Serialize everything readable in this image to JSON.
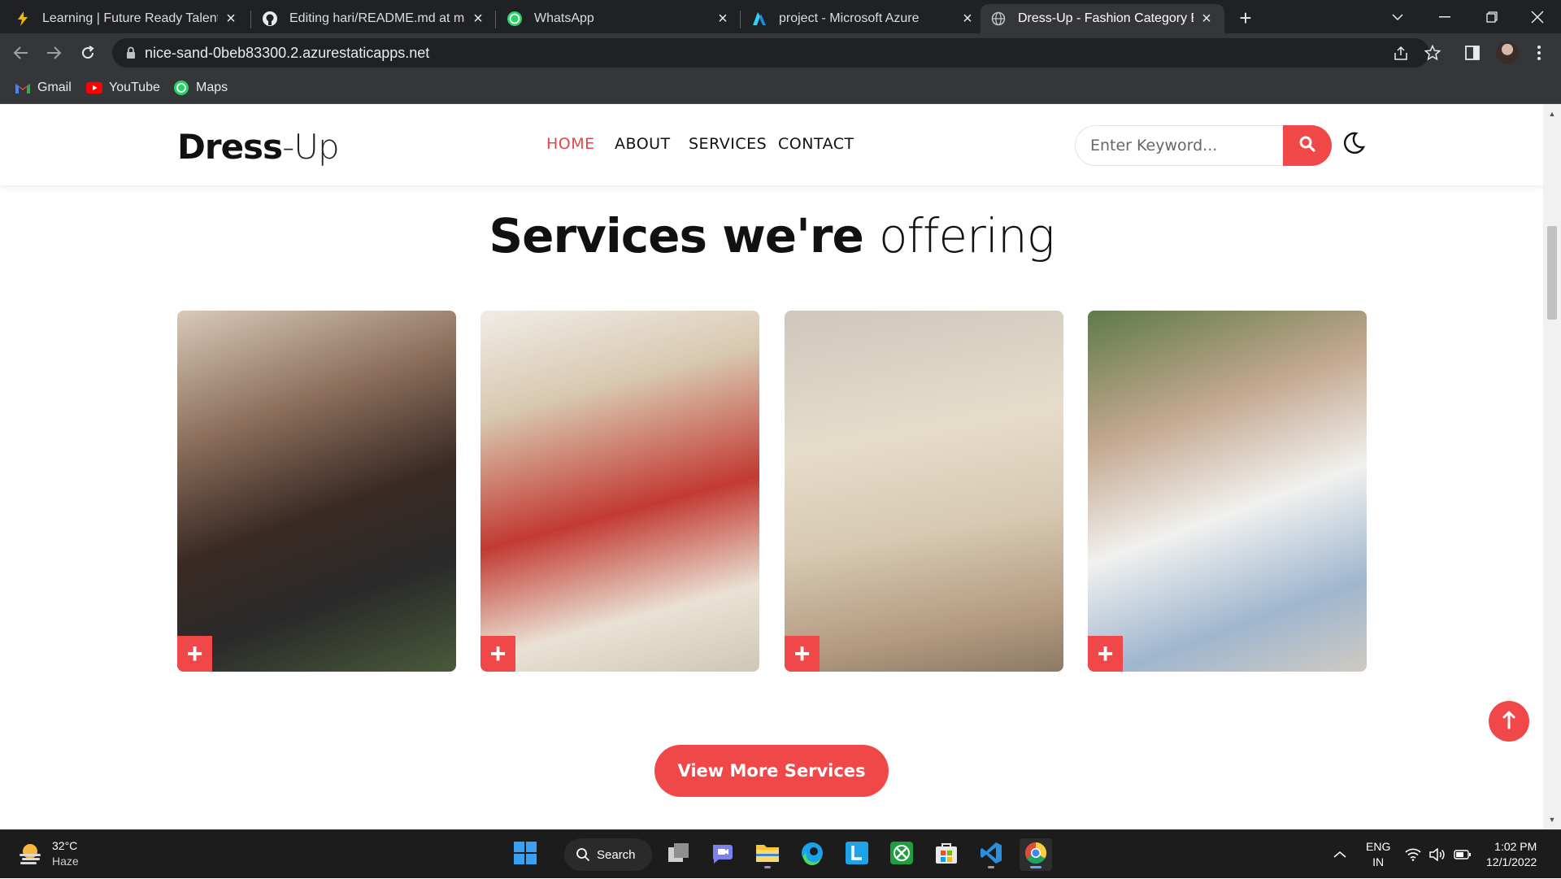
{
  "browser": {
    "tabs": [
      {
        "title": "Learning | Future Ready Talent",
        "icon": "bolt-icon"
      },
      {
        "title": "Editing hari/README.md at main",
        "icon": "github-icon"
      },
      {
        "title": "WhatsApp",
        "icon": "whatsapp-icon"
      },
      {
        "title": "project - Microsoft Azure",
        "icon": "azure-icon"
      },
      {
        "title": "Dress-Up - Fashion Category Boo",
        "icon": "globe-icon"
      }
    ],
    "url": "nice-sand-0beb83300.2.azurestaticapps.net",
    "bookmarks": [
      {
        "label": "Gmail",
        "icon": "gmail-icon"
      },
      {
        "label": "YouTube",
        "icon": "youtube-icon"
      },
      {
        "label": "Maps",
        "icon": "maps-icon"
      }
    ]
  },
  "site": {
    "logo_bold": "Dress",
    "logo_light": "-Up",
    "nav": [
      "HOME",
      "ABOUT",
      "SERVICES",
      "CONTACT"
    ],
    "search_placeholder": "Enter Keyword...",
    "section_title_bold": "Services we're",
    "section_title_light": "offering",
    "cards": [
      {
        "name": "tape-measure-fitting",
        "plus": "+"
      },
      {
        "name": "sewing-machine",
        "plus": "+"
      },
      {
        "name": "tailoring-cutting",
        "plus": "+"
      },
      {
        "name": "hand-sewing",
        "plus": "+"
      }
    ],
    "cta_label": "View More Services"
  },
  "taskbar": {
    "temperature": "32°C",
    "weather": "Haze",
    "search_label": "Search",
    "language": "ENG",
    "region": "IN",
    "time": "1:02 PM",
    "date": "12/1/2022"
  },
  "colors": {
    "accent": "#f04848",
    "chrome_dark": "#202124",
    "chrome_toolbar": "#35363a",
    "taskbar": "#1c1c1c"
  }
}
